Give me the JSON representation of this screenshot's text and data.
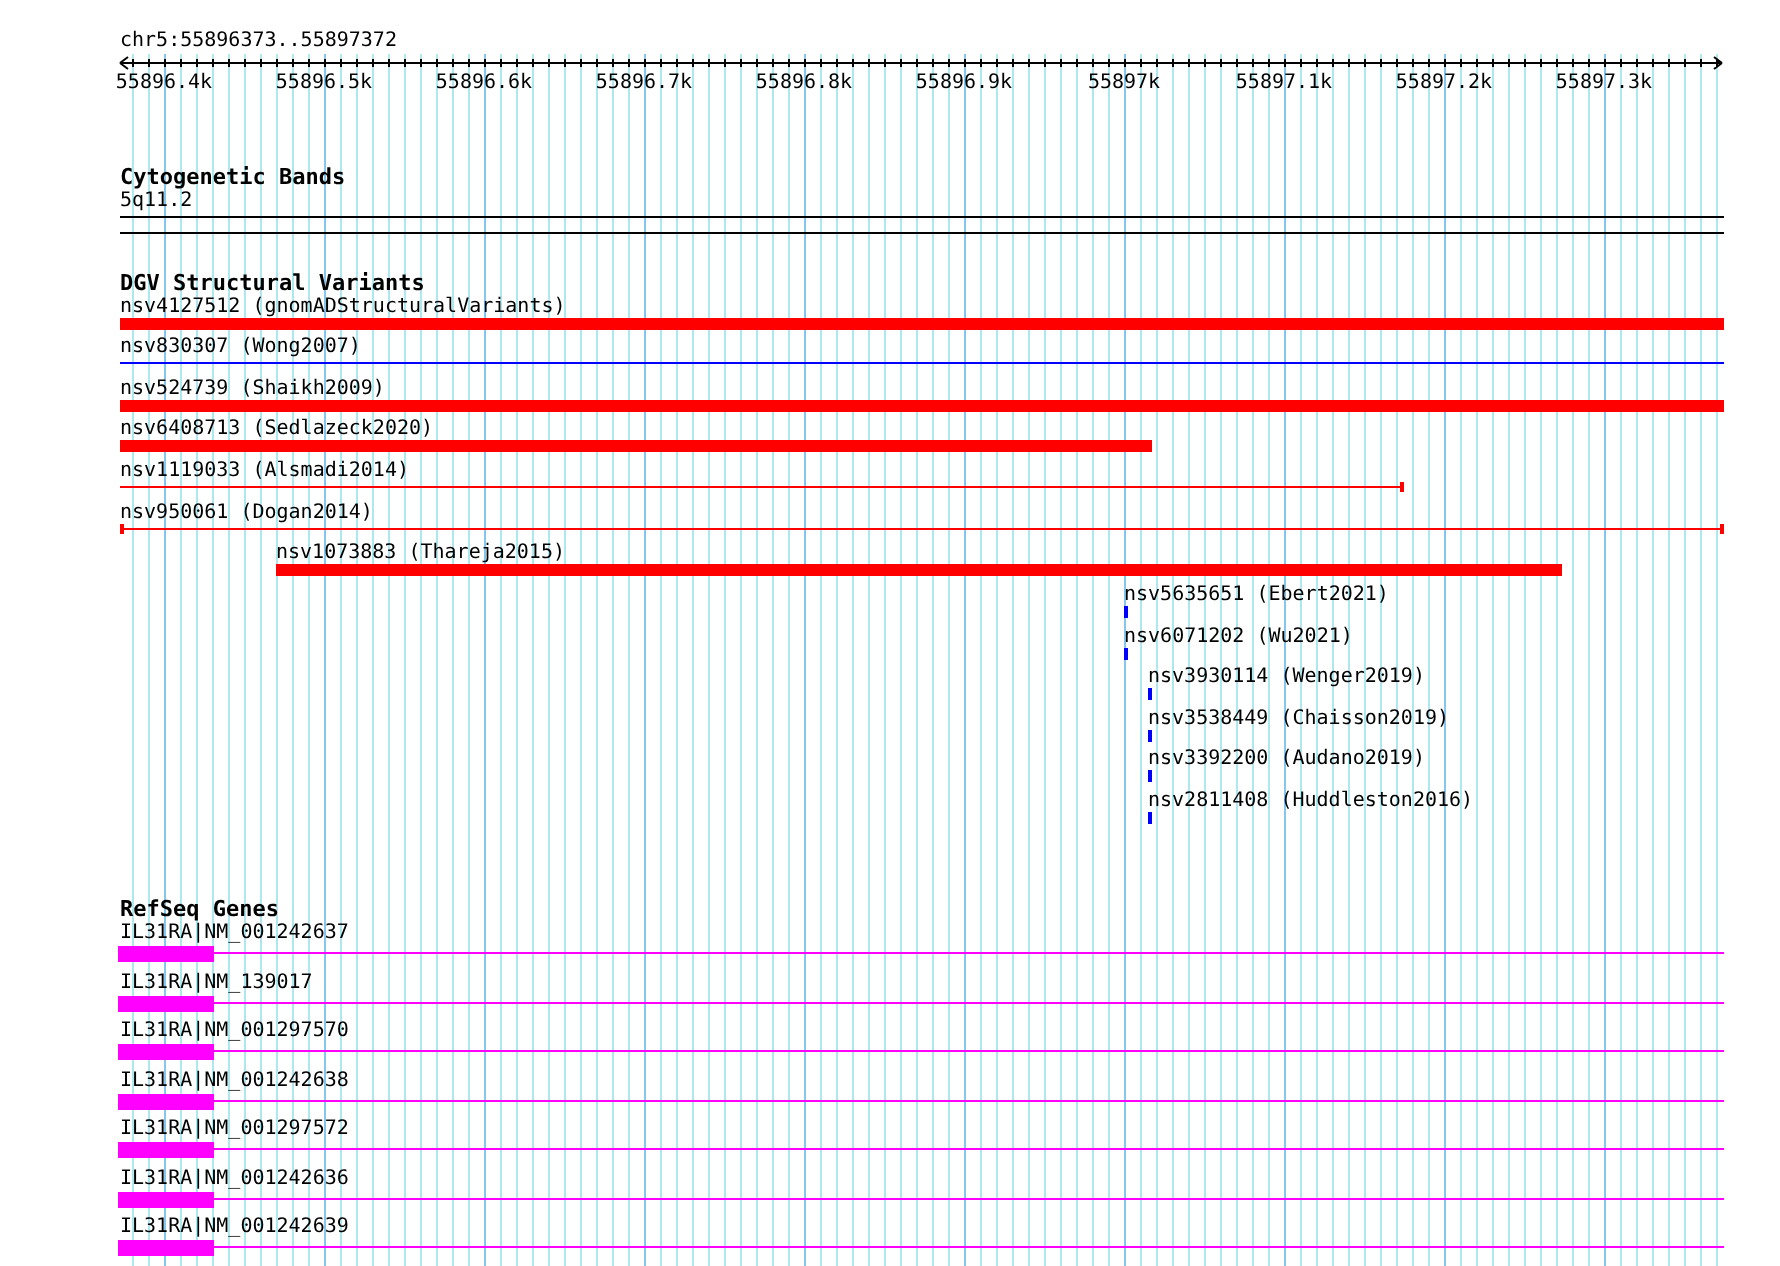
{
  "location": "chr5:55896373..55897372",
  "ruler": {
    "ticks": [
      "55896.4k",
      "55896.5k",
      "55896.6k",
      "55896.7k",
      "55896.8k",
      "55896.9k",
      "55897k",
      "55897.1k",
      "55897.2k",
      "55897.3k"
    ]
  },
  "cytogenetic_bands": {
    "title": "Cytogenetic Bands",
    "bands": [
      {
        "label": "5q11.2"
      }
    ]
  },
  "dgv": {
    "title": "DGV Structural Variants",
    "variants": [
      {
        "label": "nsv4127512 (gnomADStructuralVariants)",
        "kind": "bar",
        "color": "#ff0000"
      },
      {
        "label": "nsv830307 (Wong2007)",
        "kind": "line",
        "color": "#0000ff"
      },
      {
        "label": "nsv524739 (Shaikh2009)",
        "kind": "bar",
        "color": "#ff0000"
      },
      {
        "label": "nsv6408713 (Sedlazeck2020)",
        "kind": "bar",
        "color": "#ff0000"
      },
      {
        "label": "nsv1119033 (Alsmadi2014)",
        "kind": "end-capped-line",
        "color": "#ff0000"
      },
      {
        "label": "nsv950061 (Dogan2014)",
        "kind": "capped-line",
        "color": "#ff0000"
      },
      {
        "label": "nsv1073883 (Thareja2015)",
        "kind": "bar",
        "color": "#ff0000"
      },
      {
        "label": "nsv5635651 (Ebert2021)",
        "kind": "dash",
        "color": "#0000ff"
      },
      {
        "label": "nsv6071202 (Wu2021)",
        "kind": "dash",
        "color": "#0000ff"
      },
      {
        "label": "nsv3930114 (Wenger2019)",
        "kind": "dash",
        "color": "#0000ff"
      },
      {
        "label": "nsv3538449 (Chaisson2019)",
        "kind": "dash",
        "color": "#0000ff"
      },
      {
        "label": "nsv3392200 (Audano2019)",
        "kind": "dash",
        "color": "#0000ff"
      },
      {
        "label": "nsv2811408 (Huddleston2016)",
        "kind": "dash",
        "color": "#0000ff"
      }
    ]
  },
  "refseq": {
    "title": "RefSeq Genes",
    "genes": [
      {
        "label": "IL31RA|NM_001242637"
      },
      {
        "label": "IL31RA|NM_139017"
      },
      {
        "label": "IL31RA|NM_001297570"
      },
      {
        "label": "IL31RA|NM_001242638"
      },
      {
        "label": "IL31RA|NM_001297572"
      },
      {
        "label": "IL31RA|NM_001242636"
      },
      {
        "label": "IL31RA|NM_001242639"
      }
    ]
  }
}
